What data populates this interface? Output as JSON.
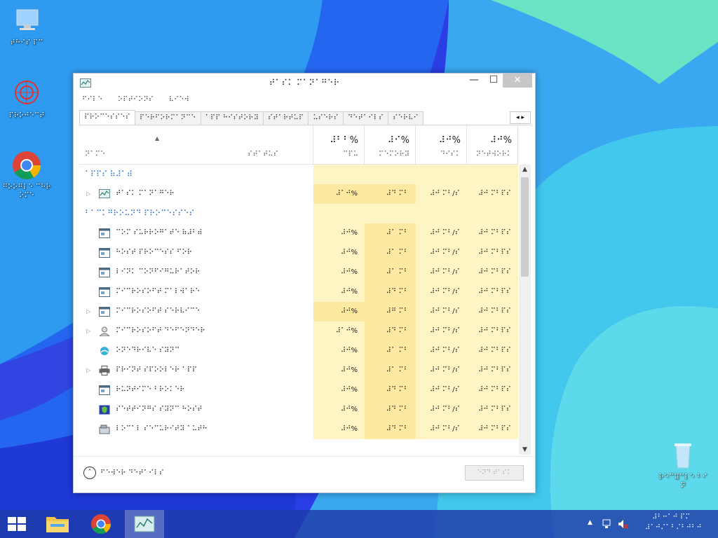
{
  "desktop": {
    "icons": [
      {
        "label": "⠞⠓⠊⠎ ⠏⠉"
      },
      {
        "label": "⠏⠗⠕⠚⠑⠉⠞"
      },
      {
        "label": "⠛⠕⠕⠛⠇⠑ ⠉⠓⠗⠕⠍⠑"
      },
      {
        "label": "⠗⠑⠉⠽⠉⠇⠑ ⠃⠊⠝"
      }
    ]
  },
  "window": {
    "title": "⠞⠁⠎⠅ ⠍⠁⠝⠁⠛⠑⠗",
    "minimize_glyph": "—",
    "maximize_glyph": "☐",
    "close_glyph": "✕"
  },
  "menu": [
    "⠋⠊⠇⠑",
    "⠕⠏⠞⠊⠕⠝⠎",
    "⠧⠊⠑⠺"
  ],
  "tabs": [
    {
      "label": "⠏⠗⠕⠉⠑⠎⠎⠑⠎",
      "active": true
    },
    {
      "label": "⠏⠑⠗⠋⠕⠗⠍⠁⠝⠉⠑",
      "active": false
    },
    {
      "label": "⠁⠏⠏ ⠓⠊⠎⠞⠕⠗⠽",
      "active": false
    },
    {
      "label": "⠎⠞⠁⠗⠞⠥⠏",
      "active": false
    },
    {
      "label": "⠥⠎⠑⠗⠎",
      "active": false
    },
    {
      "label": "⠙⠑⠞⠁⠊⠇⠎",
      "active": false
    },
    {
      "label": "⠎⠑⠗⠧⠊",
      "active": false
    }
  ],
  "tab_scroll": "◂ ▸",
  "columns": {
    "name": {
      "label": "⠝⠁⠍⠑"
    },
    "status": {
      "label": "⠎⠞⠁⠞⠥⠎"
    },
    "cpu": {
      "pct": "⠼⠃⠃%",
      "label": "⠉⠏⠥"
    },
    "memory": {
      "pct": "⠼⠊%",
      "label": "⠍⠑⠍⠕⠗⠽"
    },
    "disk": {
      "pct": "⠼⠚%",
      "label": "⠙⠊⠎⠅"
    },
    "network": {
      "pct": "⠼⠚%",
      "label": "⠝⠑⠞⠺⠕⠗⠅"
    }
  },
  "sort_arrow": "▲",
  "groups": {
    "apps": "⠁⠏⠏⠎ ⠷⠼⠁⠾",
    "background": "⠃⠁⠉⠅⠛⠗⠕⠥⠝⠙ ⠏⠗⠕⠉⠑⠎⠎⠑⠎"
  },
  "rows": [
    {
      "name": "⠞⠁⠎⠅ ⠍⠁⠝⠁⠛⠑⠗",
      "cpu": "⠼⠁⠚%",
      "mem": "⠼⠙ ⠍⠃",
      "disk": "⠼⠚ ⠍⠃/⠎",
      "net": "⠼⠚ ⠍⠃⠏⠎",
      "expand": "▷",
      "icon": "task-manager"
    },
    {
      "name": "⠉⠕⠍ ⠎⠥⠗⠗⠕⠛⠁⠞⠑ ⠷⠼⠃⠾",
      "cpu": "⠼⠚%",
      "mem": "⠼⠁ ⠍⠃",
      "disk": "⠼⠚ ⠍⠃/⠎",
      "net": "⠼⠚ ⠍⠃⠏⠎",
      "expand": "",
      "icon": "app"
    },
    {
      "name": "⠓⠕⠎⠞ ⠏⠗⠕⠉⠑⠎⠎ ⠋⠕⠗⠀⠀",
      "cpu": "⠼⠚%",
      "mem": "⠼⠁ ⠍⠃",
      "disk": "⠼⠚ ⠍⠃/⠎",
      "net": "⠼⠚ ⠍⠃⠏⠎",
      "expand": "",
      "icon": "app"
    },
    {
      "name": "⠇⠊⠝⠅ ⠉⠕⠝⠋⠊⠛⠥⠗⠁⠞⠕⠗⠀⠀",
      "cpu": "⠼⠚%",
      "mem": "⠼⠁ ⠍⠃",
      "disk": "⠼⠚ ⠍⠃/⠎",
      "net": "⠼⠚ ⠍⠃⠏⠎",
      "expand": "",
      "icon": "app"
    },
    {
      "name": "⠍⠊⠉⠗⠕⠎⠕⠋⠞ ⠍⠁⠇⠺⠁⠗⠑⠀⠀",
      "cpu": "⠼⠚%",
      "mem": "⠼⠙ ⠍⠃",
      "disk": "⠼⠚ ⠍⠃/⠎",
      "net": "⠼⠚ ⠍⠃⠏⠎",
      "expand": "",
      "icon": "app"
    },
    {
      "name": "⠍⠊⠉⠗⠕⠎⠕⠋⠞ ⠎⠑⠗⠧⠊⠉⠑⠀⠀",
      "cpu": "⠼⠚%",
      "mem": "⠼⠛ ⠍⠃",
      "disk": "⠼⠚ ⠍⠃/⠎",
      "net": "⠼⠚ ⠍⠃⠏⠎",
      "expand": "▷",
      "icon": "app"
    },
    {
      "name": "⠍⠊⠉⠗⠕⠎⠕⠋⠞ ⠙⠑⠋⠑⠝⠙⠑⠗⠀⠀",
      "cpu": "⠼⠁⠚%",
      "mem": "⠼⠙ ⠍⠃",
      "disk": "⠼⠚ ⠍⠃/⠎",
      "net": "⠼⠚ ⠍⠃⠏⠎",
      "expand": "▷",
      "icon": "user"
    },
    {
      "name": "⠕⠝⠑⠙⠗⠊⠧⠑ ⠎⠽⠝⠉",
      "cpu": "⠼⠚%",
      "mem": "⠼⠁ ⠍⠃",
      "disk": "⠼⠚ ⠍⠃/⠎",
      "net": "⠼⠚ ⠍⠃⠏⠎",
      "expand": "",
      "icon": "cloud"
    },
    {
      "name": "⠏⠗⠊⠝⠞ ⠎⠏⠕⠕⠇⠑⠗ ⠁⠏⠏⠀⠀",
      "cpu": "⠼⠚%",
      "mem": "⠼⠁ ⠍⠃",
      "disk": "⠼⠚ ⠍⠃/⠎",
      "net": "⠼⠚ ⠍⠃⠏⠎",
      "expand": "▷",
      "icon": "printer"
    },
    {
      "name": "⠗⠥⠝⠞⠊⠍⠑ ⠃⠗⠕⠅⠑⠗⠀⠀",
      "cpu": "⠼⠚%",
      "mem": "⠼⠙ ⠍⠃",
      "disk": "⠼⠚ ⠍⠃/⠎",
      "net": "⠼⠚ ⠍⠃⠏⠎",
      "expand": "",
      "icon": "app"
    },
    {
      "name": "⠎⠑⠞⠞⠊⠝⠛⠎ ⠎⠽⠝⠉ ⠓⠕⠎⠞⠀⠀",
      "cpu": "⠼⠚%",
      "mem": "⠼⠙ ⠍⠃",
      "disk": "⠼⠚ ⠍⠃/⠎",
      "net": "⠼⠚ ⠍⠃⠏⠎",
      "expand": "",
      "icon": "shield"
    },
    {
      "name": "⠇⠕⠉⠁⠇ ⠎⠑⠉⠥⠗⠊⠞⠽ ⠁⠥⠞⠓",
      "cpu": "⠼⠚%",
      "mem": "⠼⠙ ⠍⠃",
      "disk": "⠼⠚ ⠍⠃/⠎",
      "net": "⠼⠚ ⠍⠃⠏⠎",
      "expand": "",
      "icon": "disk"
    }
  ],
  "footer": {
    "fewer_details": "⠋⠑⠺⠑⠗ ⠙⠑⠞⠁⠊⠇⠎",
    "end_task": "⠑⠝⠙ ⠞⠁⠎⠅"
  },
  "tray": {
    "time": "⠼⠃⠒⠁⠚ ⠏⠍",
    "date": "⠼⠁⠚⠌⠁⠃⠌⠃⠚⠃⠚"
  },
  "colors": {
    "accent": "#1e6bd6",
    "cpu_highlight": "#fff4c4",
    "cpu_strong": "#fde9a0"
  }
}
